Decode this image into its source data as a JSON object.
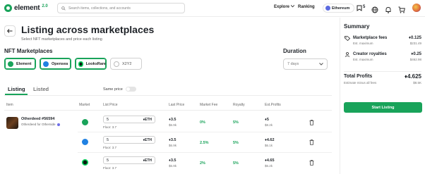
{
  "header": {
    "brand": "element",
    "version": "2.0",
    "search_placeholder": "Search items, collections, and accounts",
    "nav_explore": "Explore",
    "nav_explore_icon": "chevron-down-icon",
    "nav_ranking": "Ranking",
    "chain": "Ethereum",
    "wallet_count": "5"
  },
  "page": {
    "title": "Listing across marketplaces",
    "subtitle": "Select NFT marketplaces and price each listing"
  },
  "marketplaces": {
    "label": "NFT Marketplaces",
    "items": [
      {
        "name": "Element",
        "selected": true,
        "color": "#19a35a"
      },
      {
        "name": "Opensea",
        "selected": true,
        "color": "#2081e2"
      },
      {
        "name": "LooksRare",
        "selected": true,
        "color": "#0ce466"
      },
      {
        "name": "X2Y2",
        "selected": false,
        "color": "#cfcfcf"
      }
    ]
  },
  "duration": {
    "label": "Duration",
    "value": "7 days"
  },
  "tabs": {
    "listing": "Listing",
    "listed": "Listed",
    "same_price": "Same price"
  },
  "table": {
    "headers": [
      "Item",
      "Market",
      "List Price",
      "Last Price",
      "Market Fee",
      "Royalty",
      "Est.Profits"
    ],
    "item": {
      "name": "Otherdeed #56594",
      "collection": "Otherdeed for Otherside"
    },
    "rows": [
      {
        "market": "element",
        "market_color": "#19a35a",
        "price": "5",
        "currency": "ETH",
        "floor": "Floor: 3.7",
        "last_price": "3.5",
        "last_price_usd": "$6.9k",
        "fee": "0%",
        "royalty": "5%",
        "profit": "5",
        "profit_usd": "$8.2k"
      },
      {
        "market": "opensea",
        "market_color": "#2081e2",
        "price": "5",
        "currency": "ETH",
        "floor": "Floor: 3.7",
        "last_price": "3.5",
        "last_price_usd": "$6.9k",
        "fee": "2.5%",
        "royalty": "5%",
        "profit": "4.62",
        "profit_usd": "$6.1k"
      },
      {
        "market": "looksrare",
        "market_color": "#0b1a0f",
        "price": "5",
        "currency": "ETH",
        "floor": "Floor: 3.7",
        "last_price": "3.5",
        "last_price_usd": "$6.9k",
        "fee": "2%",
        "royalty": "5%",
        "profit": "4.65",
        "profit_usd": "$6.2k"
      }
    ]
  },
  "summary": {
    "title": "Summary",
    "marketplace_fees_label": "Marketplace fees",
    "marketplace_fees_value": "0.125",
    "marketplace_fees_sub": "Est. maximum",
    "marketplace_fees_usd": "$231.49",
    "creator_royalties_label": "Creator royalties",
    "creator_royalties_value": "0.25",
    "creator_royalties_sub": "Est. maximum",
    "creator_royalties_usd": "$462.98",
    "total_label": "Total Profits",
    "total_value": "4.625",
    "total_sub": "Estimate minus all fees",
    "total_usd": "$8.5K",
    "start_button": "Start Listing"
  }
}
